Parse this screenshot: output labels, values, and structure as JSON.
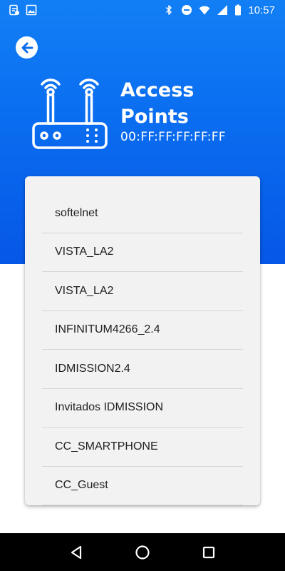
{
  "status_bar": {
    "time": "10:57",
    "left_icons": [
      "screencast-notification-icon",
      "image-notification-icon"
    ],
    "right_icons": [
      "bluetooth-icon",
      "do-not-disturb-icon",
      "wifi-icon",
      "cell-signal-icon",
      "battery-icon"
    ]
  },
  "header": {
    "title": "Access Points",
    "title_line1": "Access",
    "title_line2": "Points",
    "mac_address": "00:FF:FF:FF:FF:FF",
    "back_icon": "arrow-left-circle-icon",
    "router_icon": "router-icon"
  },
  "access_points": [
    {
      "ssid": "softelnet"
    },
    {
      "ssid": "VISTA_LA2"
    },
    {
      "ssid": "VISTA_LA2"
    },
    {
      "ssid": "INFINITUM4266_2.4"
    },
    {
      "ssid": "IDMISSION2.4"
    },
    {
      "ssid": "Invitados IDMISSION"
    },
    {
      "ssid": "CC_SMARTPHONE"
    },
    {
      "ssid": "CC_Guest"
    }
  ],
  "nav_bar": {
    "buttons": [
      "back-triangle-icon",
      "home-circle-icon",
      "recents-square-icon"
    ]
  },
  "colors": {
    "header_blue_top": "#127ff5",
    "header_blue_bottom": "#0657e6",
    "card_background": "#f2f2f2",
    "divider": "#d6d6d6",
    "text_primary": "#212121",
    "nav_bar": "#000000"
  }
}
